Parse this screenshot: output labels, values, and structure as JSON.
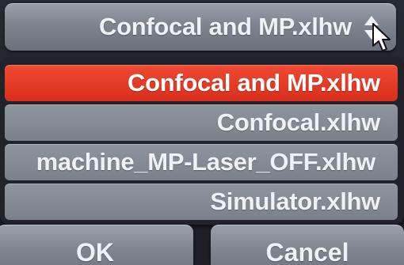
{
  "select": {
    "value": "Confocal and MP.xlhw",
    "icon": "updown-arrows-icon",
    "cursor": "mouse-pointer-icon"
  },
  "dropdown": {
    "options": [
      {
        "label": "Confocal and MP.xlhw",
        "selected": true
      },
      {
        "label": "Confocal.xlhw",
        "selected": false
      },
      {
        "label": "machine_MP-Laser_OFF.xlhw",
        "selected": false
      },
      {
        "label": "Simulator.xlhw",
        "selected": false
      }
    ]
  },
  "buttons": {
    "ok_label": "OK",
    "cancel_label": "Cancel"
  },
  "colors": {
    "selected": "#e03a26",
    "option": "#858c96",
    "background": "#1d2127"
  }
}
